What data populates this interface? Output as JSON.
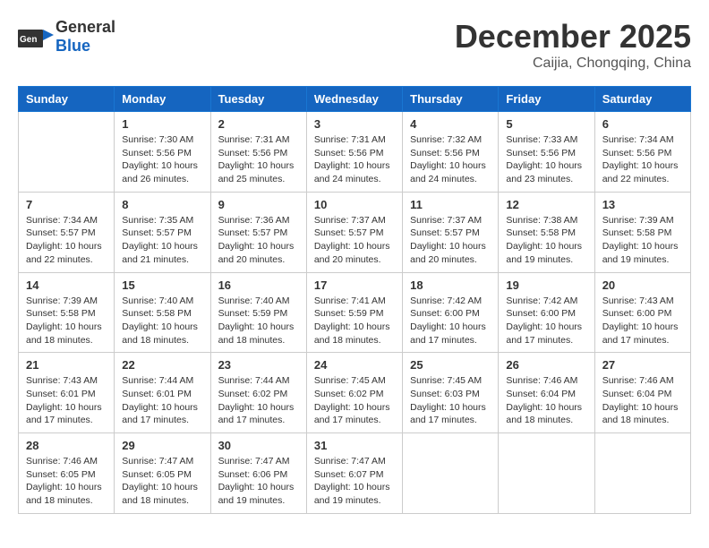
{
  "header": {
    "logo_general": "General",
    "logo_blue": "Blue",
    "month": "December 2025",
    "location": "Caijia, Chongqing, China"
  },
  "weekdays": [
    "Sunday",
    "Monday",
    "Tuesday",
    "Wednesday",
    "Thursday",
    "Friday",
    "Saturday"
  ],
  "weeks": [
    [
      {
        "day": "",
        "info": ""
      },
      {
        "day": "1",
        "info": "Sunrise: 7:30 AM\nSunset: 5:56 PM\nDaylight: 10 hours\nand 26 minutes."
      },
      {
        "day": "2",
        "info": "Sunrise: 7:31 AM\nSunset: 5:56 PM\nDaylight: 10 hours\nand 25 minutes."
      },
      {
        "day": "3",
        "info": "Sunrise: 7:31 AM\nSunset: 5:56 PM\nDaylight: 10 hours\nand 24 minutes."
      },
      {
        "day": "4",
        "info": "Sunrise: 7:32 AM\nSunset: 5:56 PM\nDaylight: 10 hours\nand 24 minutes."
      },
      {
        "day": "5",
        "info": "Sunrise: 7:33 AM\nSunset: 5:56 PM\nDaylight: 10 hours\nand 23 minutes."
      },
      {
        "day": "6",
        "info": "Sunrise: 7:34 AM\nSunset: 5:56 PM\nDaylight: 10 hours\nand 22 minutes."
      }
    ],
    [
      {
        "day": "7",
        "info": "Sunrise: 7:34 AM\nSunset: 5:57 PM\nDaylight: 10 hours\nand 22 minutes."
      },
      {
        "day": "8",
        "info": "Sunrise: 7:35 AM\nSunset: 5:57 PM\nDaylight: 10 hours\nand 21 minutes."
      },
      {
        "day": "9",
        "info": "Sunrise: 7:36 AM\nSunset: 5:57 PM\nDaylight: 10 hours\nand 20 minutes."
      },
      {
        "day": "10",
        "info": "Sunrise: 7:37 AM\nSunset: 5:57 PM\nDaylight: 10 hours\nand 20 minutes."
      },
      {
        "day": "11",
        "info": "Sunrise: 7:37 AM\nSunset: 5:57 PM\nDaylight: 10 hours\nand 20 minutes."
      },
      {
        "day": "12",
        "info": "Sunrise: 7:38 AM\nSunset: 5:58 PM\nDaylight: 10 hours\nand 19 minutes."
      },
      {
        "day": "13",
        "info": "Sunrise: 7:39 AM\nSunset: 5:58 PM\nDaylight: 10 hours\nand 19 minutes."
      }
    ],
    [
      {
        "day": "14",
        "info": "Sunrise: 7:39 AM\nSunset: 5:58 PM\nDaylight: 10 hours\nand 18 minutes."
      },
      {
        "day": "15",
        "info": "Sunrise: 7:40 AM\nSunset: 5:58 PM\nDaylight: 10 hours\nand 18 minutes."
      },
      {
        "day": "16",
        "info": "Sunrise: 7:40 AM\nSunset: 5:59 PM\nDaylight: 10 hours\nand 18 minutes."
      },
      {
        "day": "17",
        "info": "Sunrise: 7:41 AM\nSunset: 5:59 PM\nDaylight: 10 hours\nand 18 minutes."
      },
      {
        "day": "18",
        "info": "Sunrise: 7:42 AM\nSunset: 6:00 PM\nDaylight: 10 hours\nand 17 minutes."
      },
      {
        "day": "19",
        "info": "Sunrise: 7:42 AM\nSunset: 6:00 PM\nDaylight: 10 hours\nand 17 minutes."
      },
      {
        "day": "20",
        "info": "Sunrise: 7:43 AM\nSunset: 6:00 PM\nDaylight: 10 hours\nand 17 minutes."
      }
    ],
    [
      {
        "day": "21",
        "info": "Sunrise: 7:43 AM\nSunset: 6:01 PM\nDaylight: 10 hours\nand 17 minutes."
      },
      {
        "day": "22",
        "info": "Sunrise: 7:44 AM\nSunset: 6:01 PM\nDaylight: 10 hours\nand 17 minutes."
      },
      {
        "day": "23",
        "info": "Sunrise: 7:44 AM\nSunset: 6:02 PM\nDaylight: 10 hours\nand 17 minutes."
      },
      {
        "day": "24",
        "info": "Sunrise: 7:45 AM\nSunset: 6:02 PM\nDaylight: 10 hours\nand 17 minutes."
      },
      {
        "day": "25",
        "info": "Sunrise: 7:45 AM\nSunset: 6:03 PM\nDaylight: 10 hours\nand 17 minutes."
      },
      {
        "day": "26",
        "info": "Sunrise: 7:46 AM\nSunset: 6:04 PM\nDaylight: 10 hours\nand 18 minutes."
      },
      {
        "day": "27",
        "info": "Sunrise: 7:46 AM\nSunset: 6:04 PM\nDaylight: 10 hours\nand 18 minutes."
      }
    ],
    [
      {
        "day": "28",
        "info": "Sunrise: 7:46 AM\nSunset: 6:05 PM\nDaylight: 10 hours\nand 18 minutes."
      },
      {
        "day": "29",
        "info": "Sunrise: 7:47 AM\nSunset: 6:05 PM\nDaylight: 10 hours\nand 18 minutes."
      },
      {
        "day": "30",
        "info": "Sunrise: 7:47 AM\nSunset: 6:06 PM\nDaylight: 10 hours\nand 19 minutes."
      },
      {
        "day": "31",
        "info": "Sunrise: 7:47 AM\nSunset: 6:07 PM\nDaylight: 10 hours\nand 19 minutes."
      },
      {
        "day": "",
        "info": ""
      },
      {
        "day": "",
        "info": ""
      },
      {
        "day": "",
        "info": ""
      }
    ]
  ]
}
